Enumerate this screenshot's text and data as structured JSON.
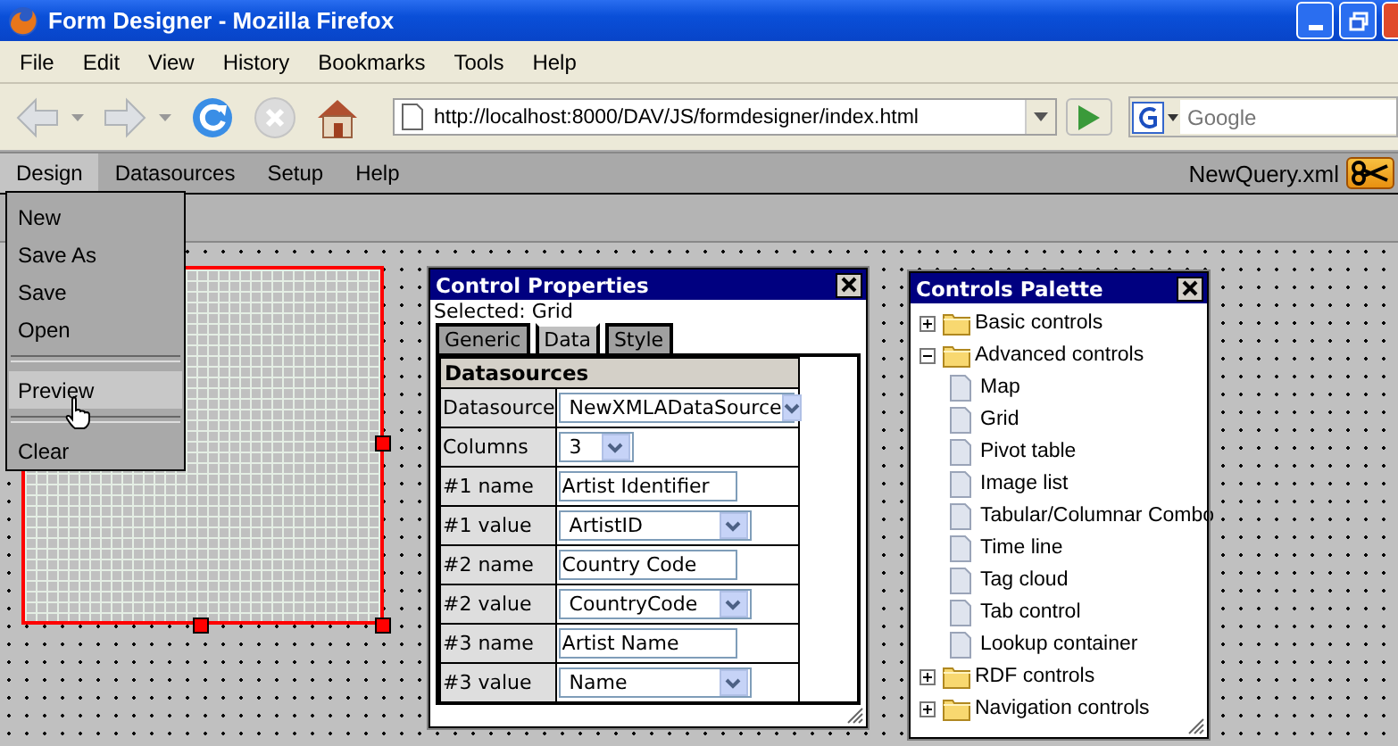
{
  "window": {
    "title": "Form Designer - Mozilla Firefox"
  },
  "browser_menu": [
    "File",
    "Edit",
    "View",
    "History",
    "Bookmarks",
    "Tools",
    "Help"
  ],
  "address_bar": {
    "value": "http://localhost:8000/DAV/JS/formdesigner/index.html"
  },
  "search": {
    "placeholder": "Google"
  },
  "app_menu": [
    {
      "label": "Design",
      "selected": true
    },
    {
      "label": "Datasources",
      "selected": false
    },
    {
      "label": "Setup",
      "selected": false
    },
    {
      "label": "Help",
      "selected": false
    }
  ],
  "file_name": "NewQuery.xml",
  "design_menu": [
    {
      "kind": "item",
      "label": "New",
      "selected": false
    },
    {
      "kind": "item",
      "label": "Save As",
      "selected": false
    },
    {
      "kind": "item",
      "label": "Save",
      "selected": false
    },
    {
      "kind": "item",
      "label": "Open",
      "selected": false
    },
    {
      "kind": "separator"
    },
    {
      "kind": "item",
      "label": "Preview",
      "selected": true
    },
    {
      "kind": "separator"
    },
    {
      "kind": "item",
      "label": "Clear",
      "selected": false
    }
  ],
  "control_properties": {
    "title": "Control Properties",
    "selected_text": "Selected: Grid",
    "tabs": [
      {
        "label": "Generic",
        "selected": false
      },
      {
        "label": "Data",
        "selected": true
      },
      {
        "label": "Style",
        "selected": false
      }
    ],
    "section": "Datasources",
    "rows": [
      {
        "label": "Datasource",
        "kind": "select",
        "value": "NewXMLADataSource"
      },
      {
        "label": "Columns",
        "kind": "select",
        "value": "3"
      },
      {
        "label": "#1 name",
        "kind": "text",
        "value": "Artist Identifier"
      },
      {
        "label": "#1 value",
        "kind": "select",
        "value": "ArtistID"
      },
      {
        "label": "#2 name",
        "kind": "text",
        "value": "Country Code"
      },
      {
        "label": "#2 value",
        "kind": "select",
        "value": "CountryCode"
      },
      {
        "label": "#3 name",
        "kind": "text",
        "value": "Artist Name"
      },
      {
        "label": "#3 value",
        "kind": "select",
        "value": "Name"
      }
    ]
  },
  "controls_palette": {
    "title": "Controls Palette",
    "tree": [
      {
        "kind": "folder",
        "label": "Basic controls",
        "expanded": false
      },
      {
        "kind": "folder",
        "label": "Advanced controls",
        "expanded": true,
        "children": [
          {
            "kind": "leaf",
            "label": "Map"
          },
          {
            "kind": "leaf",
            "label": "Grid"
          },
          {
            "kind": "leaf",
            "label": "Pivot table"
          },
          {
            "kind": "leaf",
            "label": "Image list"
          },
          {
            "kind": "leaf",
            "label": "Tabular/Columnar Combo"
          },
          {
            "kind": "leaf",
            "label": "Time line"
          },
          {
            "kind": "leaf",
            "label": "Tag cloud"
          },
          {
            "kind": "leaf",
            "label": "Tab control"
          },
          {
            "kind": "leaf",
            "label": "Lookup container"
          }
        ]
      },
      {
        "kind": "folder",
        "label": "RDF controls",
        "expanded": false
      },
      {
        "kind": "folder",
        "label": "Navigation controls",
        "expanded": false
      }
    ]
  }
}
